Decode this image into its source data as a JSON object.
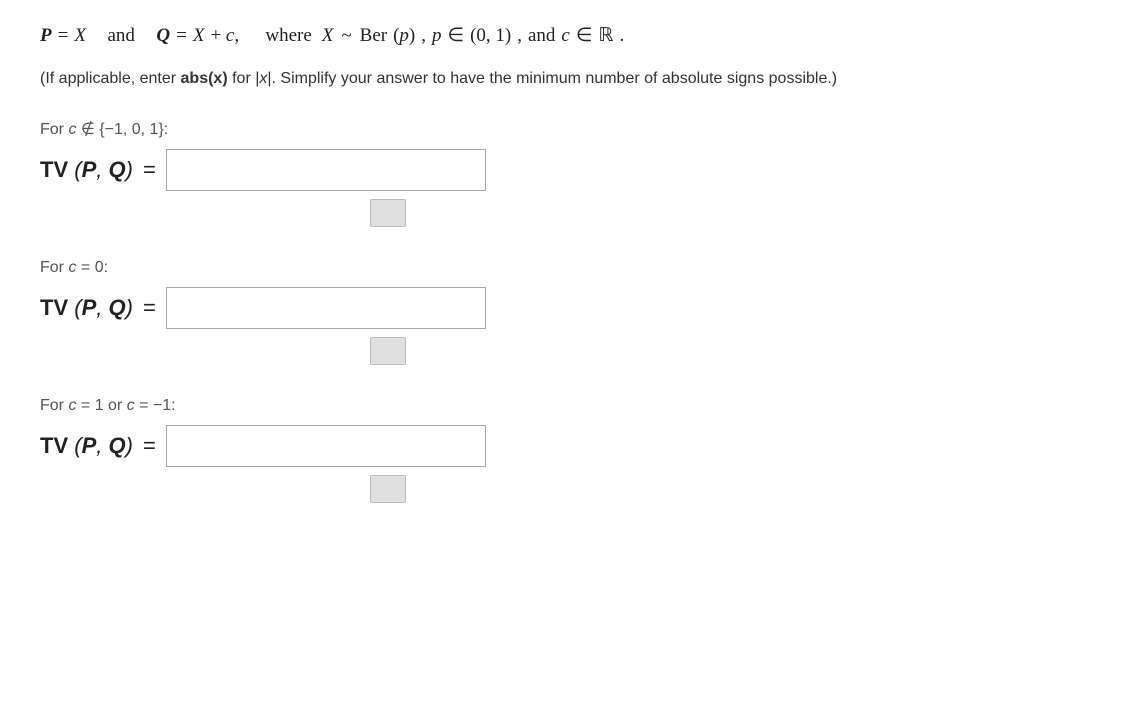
{
  "header": {
    "p_label": "P",
    "equals1": "=",
    "x1": "X",
    "and": "and",
    "q_label": "Q",
    "equals2": "=",
    "x2": "X",
    "plus_c": "+ c,",
    "where": "where",
    "x3": "X",
    "sim": "~",
    "ber": "Ber",
    "p_arg": "(p)",
    "comma1": ",",
    "p_var": "p",
    "in_sym": "∈",
    "interval": "(0, 1)",
    "comma2": ",",
    "and2": "and",
    "c_var": "c",
    "in_sym2": "∈",
    "reals": "ℝ",
    "period": "."
  },
  "instruction": {
    "prefix": "(If applicable, enter",
    "abs_label": "abs(x)",
    "for_text": "for",
    "abs_math": "|x|",
    "suffix": ". Simplify your answer to have the minimum number of absolute signs possible.)"
  },
  "cases": [
    {
      "id": "case1",
      "label": "For c ∉ {−1, 0, 1}:",
      "tv_label": "TV (P, Q)",
      "equals": "=",
      "placeholder": "",
      "input_value": ""
    },
    {
      "id": "case2",
      "label": "For c = 0:",
      "tv_label": "TV (P, Q)",
      "equals": "=",
      "placeholder": "",
      "input_value": ""
    },
    {
      "id": "case3",
      "label": "For c = 1 or c = −1:",
      "tv_label": "TV (P, Q)",
      "equals": "=",
      "placeholder": "",
      "input_value": ""
    }
  ]
}
